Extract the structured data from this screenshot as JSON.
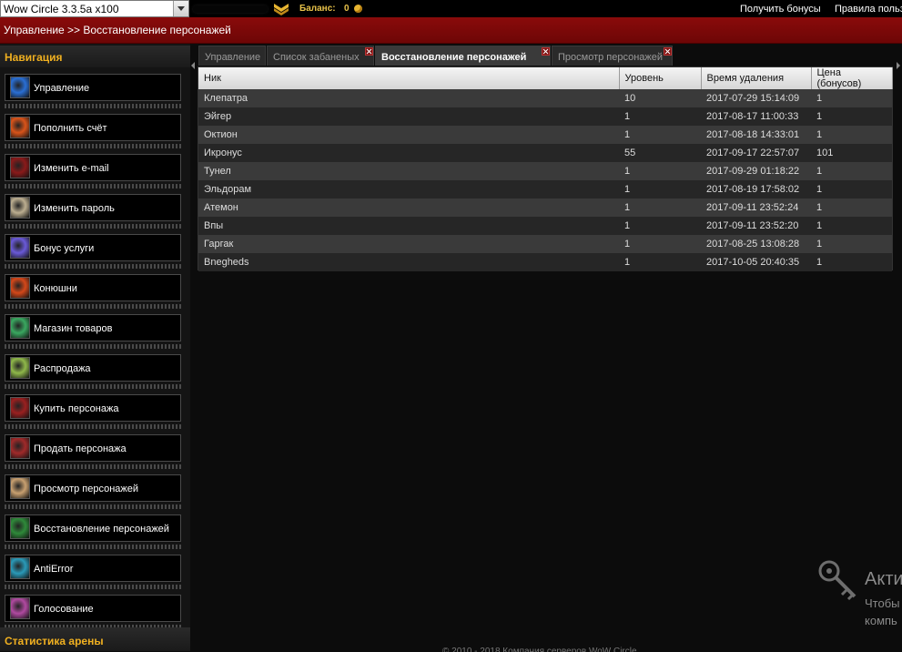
{
  "topbar": {
    "server": "Wow Circle 3.3.5a x100",
    "balance_label": "Баланс:",
    "balance_value": "0",
    "get_bonus": "Получить бонусы",
    "rules": "Правила польз"
  },
  "breadcrumb": "Управление >> Восстановление персонажей",
  "sidebar": {
    "title": "Навигация",
    "items": [
      {
        "label": "Управление",
        "icon": "management-icon",
        "color": "#2a6fd4"
      },
      {
        "label": "Пополнить счёт",
        "icon": "fire-icon",
        "color": "#d9541a"
      },
      {
        "label": "Изменить e-mail",
        "icon": "demon-icon",
        "color": "#8a1a1a"
      },
      {
        "label": "Изменить пароль",
        "icon": "face-icon",
        "color": "#bcae90"
      },
      {
        "label": "Бонус услуги",
        "icon": "sword-icon",
        "color": "#6a5ad8"
      },
      {
        "label": "Конюшни",
        "icon": "mount-icon",
        "color": "#d4481a"
      },
      {
        "label": "Магазин товаров",
        "icon": "orb-icon",
        "color": "#3aa860"
      },
      {
        "label": "Распродажа",
        "icon": "bag-icon",
        "color": "#8fb84a"
      },
      {
        "label": "Купить персонажа",
        "icon": "imp-icon",
        "color": "#9a2020"
      },
      {
        "label": "Продать персонажа",
        "icon": "imp-sell-icon",
        "color": "#a02a2a"
      },
      {
        "label": "Просмотр персонажей",
        "icon": "portrait-icon",
        "color": "#c8a070"
      },
      {
        "label": "Восстановление персонажей",
        "icon": "restore-icon",
        "color": "#2f8a3a"
      },
      {
        "label": "AntiError",
        "icon": "swirl-icon",
        "color": "#2a9ab8"
      },
      {
        "label": "Голосование",
        "icon": "vote-icon",
        "color": "#b04aa0"
      }
    ],
    "arena_title": "Статистика арены"
  },
  "tabs": [
    {
      "label": "Управление",
      "closable": false,
      "active": false
    },
    {
      "label": "Список забаненых",
      "closable": true,
      "active": false
    },
    {
      "label": "Восстановление персонажей",
      "closable": true,
      "active": true
    },
    {
      "label": "Просмотр персонажей",
      "closable": true,
      "active": false
    }
  ],
  "table": {
    "headers": [
      "Ник",
      "Уровень",
      "Время удаления",
      "Цена (бонусов)"
    ],
    "rows": [
      [
        "Клепатра",
        "10",
        "2017-07-29 15:14:09",
        "1"
      ],
      [
        "Эйгер",
        "1",
        "2017-08-17 11:00:33",
        "1"
      ],
      [
        "Октион",
        "1",
        "2017-08-18 14:33:01",
        "1"
      ],
      [
        "Икронус",
        "55",
        "2017-09-17 22:57:07",
        "101"
      ],
      [
        "Тунел",
        "1",
        "2017-09-29 01:18:22",
        "1"
      ],
      [
        "Эльдорам",
        "1",
        "2017-08-19 17:58:02",
        "1"
      ],
      [
        "Атемон",
        "1",
        "2017-09-11 23:52:24",
        "1"
      ],
      [
        "Впы",
        "1",
        "2017-09-11 23:52:20",
        "1"
      ],
      [
        "Гаргак",
        "1",
        "2017-08-25 13:08:28",
        "1"
      ],
      [
        "Bnegheds",
        "1",
        "2017-10-05 20:40:35",
        "1"
      ]
    ]
  },
  "footer": "© 2010 - 2018 Компания серверов WoW Circle",
  "watermark": {
    "line1": "Акти",
    "line2": "Чтобы",
    "line3": "компь"
  },
  "colors": {
    "accent_gold": "#f0b020",
    "header_red": "#7a0808"
  }
}
